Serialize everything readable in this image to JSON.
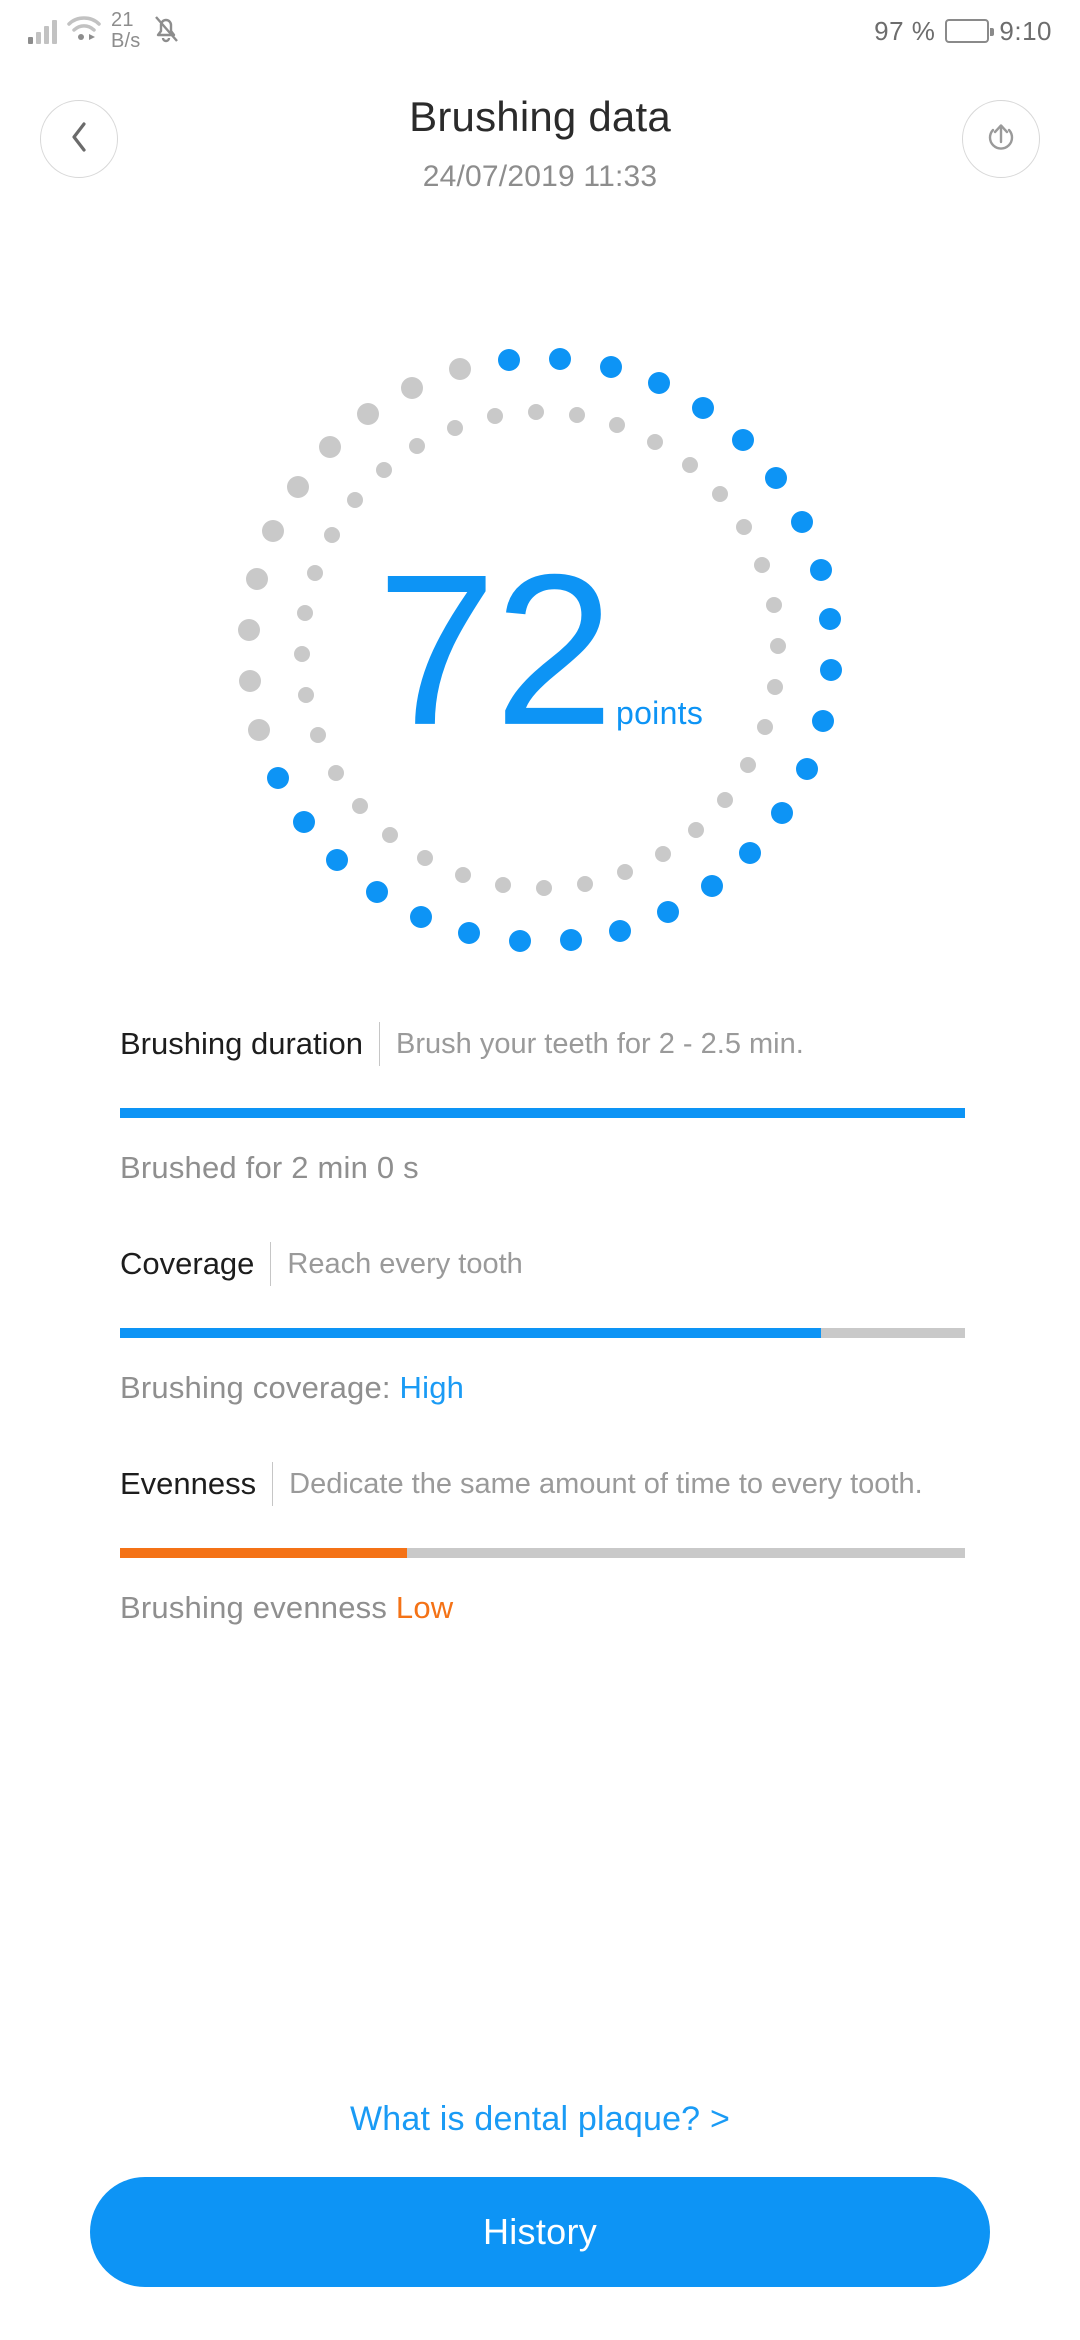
{
  "status_bar": {
    "network_speed_value": "21",
    "network_speed_unit": "B/s",
    "battery_percent": "97 %",
    "time": "9:10",
    "icons": [
      "signal-bars-icon",
      "wifi-icon",
      "notifications-muted-icon",
      "battery-icon"
    ]
  },
  "header": {
    "title": "Brushing data",
    "subtitle": "24/07/2019 11:33",
    "back_icon": "chevron-left-icon",
    "share_icon": "upload-share-icon"
  },
  "score": {
    "value": "72",
    "unit": "points",
    "max": 100,
    "accent_color": "#0d94f5",
    "track_color": "#c9c9c9"
  },
  "metrics": [
    {
      "name": "Brushing duration",
      "hint": "Brush your teeth for 2 - 2.5 min.",
      "value_text": "Brushed for 2 min 0 s",
      "value_accent": "",
      "percent": 100,
      "bar_color": "#0d94f5"
    },
    {
      "name": "Coverage",
      "hint": "Reach every tooth",
      "value_text": "Brushing coverage: ",
      "value_accent": "High",
      "percent": 83,
      "bar_color": "#0d94f5",
      "accent_color": "#1a9bf5"
    },
    {
      "name": "Evenness",
      "hint": "Dedicate the same amount of time to every tooth.",
      "value_text": "Brushing evenness ",
      "value_accent": "Low",
      "percent": 34,
      "bar_color": "#f47216",
      "accent_color": "#f47216"
    }
  ],
  "footer": {
    "plaque_link": "What is dental plaque? >",
    "history_button": "History",
    "link_color": "#1a9bf5",
    "button_color": "#0d94f5"
  },
  "chart_data": {
    "type": "pie",
    "title": "Brushing score dial",
    "value": 72,
    "max": 100,
    "unit": "points",
    "outer_ring_dots": 36,
    "inner_ring_dots": 36,
    "filled_dots": 26,
    "filled_color": "#0d94f5",
    "empty_color": "#c9c9c9"
  }
}
